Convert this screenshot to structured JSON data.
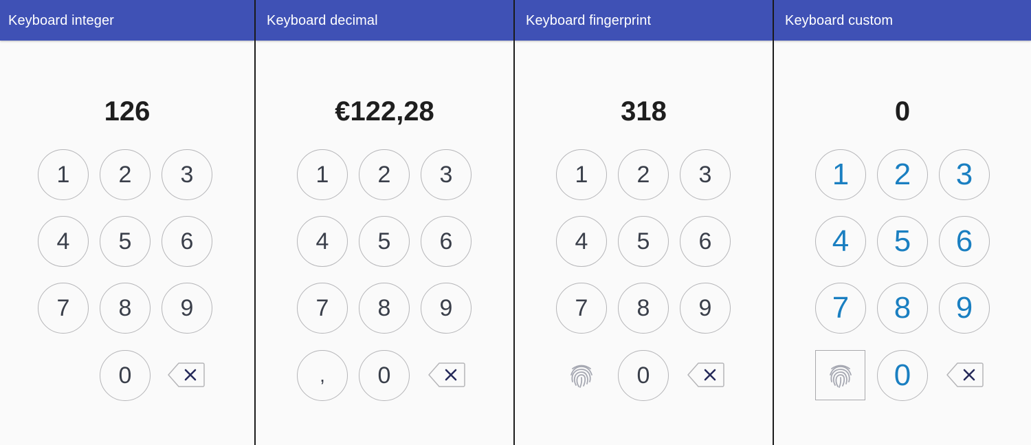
{
  "colors": {
    "appbar": "#3f51b5",
    "custom_digit": "#1a7fc1",
    "default_digit": "#3a3f4a"
  },
  "screens": [
    {
      "title": "Keyboard integer",
      "display": "126",
      "keys": [
        "1",
        "2",
        "3",
        "4",
        "5",
        "6",
        "7",
        "8",
        "9",
        "0"
      ],
      "icons": {
        "backspace": "backspace-icon"
      }
    },
    {
      "title": "Keyboard decimal",
      "display": "€122,28",
      "keys": [
        "1",
        "2",
        "3",
        "4",
        "5",
        "6",
        "7",
        "8",
        "9",
        ",",
        "0"
      ],
      "icons": {
        "backspace": "backspace-icon"
      }
    },
    {
      "title": "Keyboard fingerprint",
      "display": "318",
      "keys": [
        "1",
        "2",
        "3",
        "4",
        "5",
        "6",
        "7",
        "8",
        "9",
        "0"
      ],
      "icons": {
        "fingerprint": "fingerprint-icon",
        "backspace": "backspace-icon"
      }
    },
    {
      "title": "Keyboard custom",
      "display": "0",
      "keys": [
        "1",
        "2",
        "3",
        "4",
        "5",
        "6",
        "7",
        "8",
        "9",
        "0"
      ],
      "icons": {
        "fingerprint": "fingerprint-icon",
        "backspace": "backspace-icon"
      }
    }
  ]
}
